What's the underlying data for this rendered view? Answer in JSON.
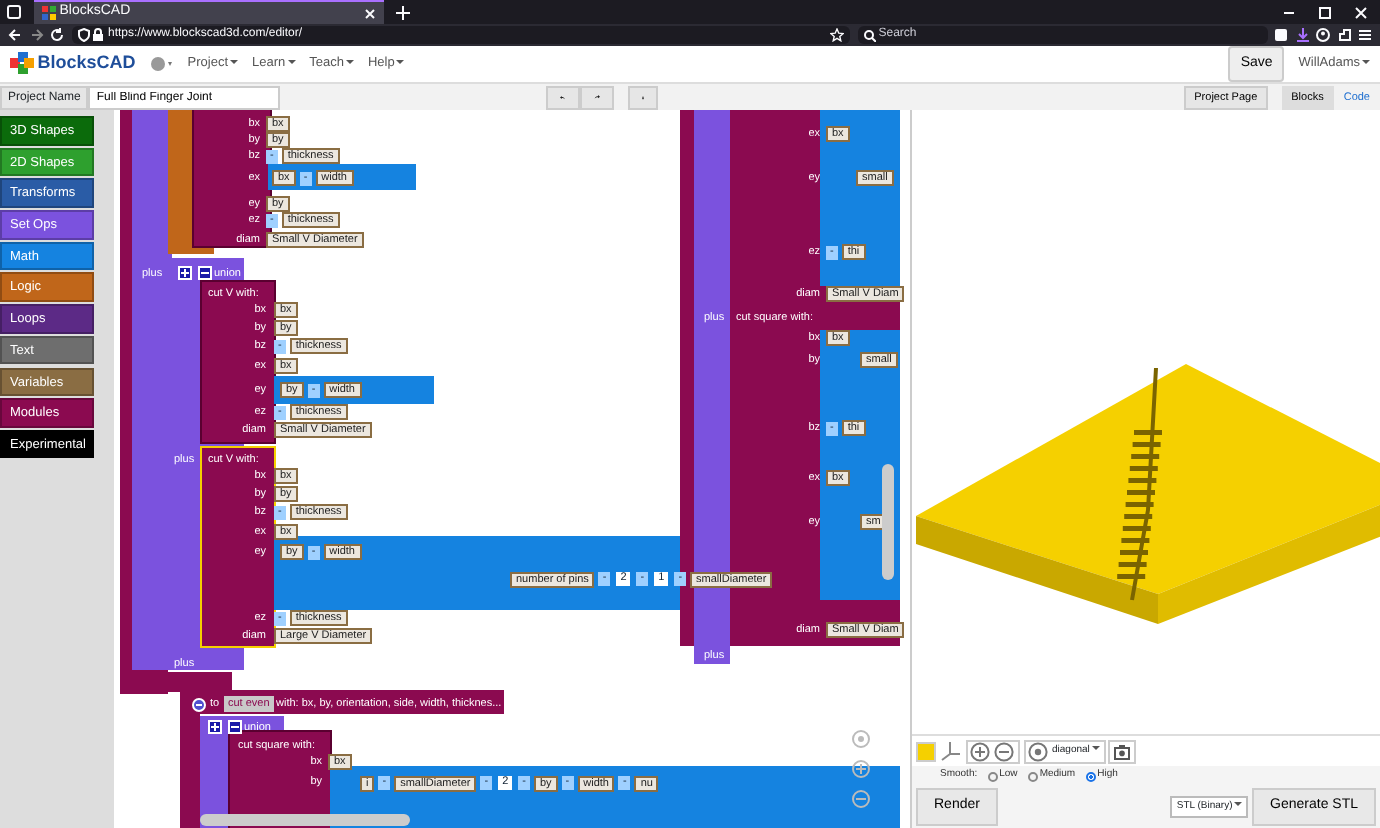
{
  "browser": {
    "tab_title": "BlocksCAD",
    "url": "https://www.blockscad3d.com/editor/",
    "search_placeholder": "Search"
  },
  "app_nav": {
    "brand": "BlocksCAD",
    "menus": [
      "Project",
      "Learn",
      "Teach",
      "Help"
    ],
    "save": "Save",
    "user": "WillAdams"
  },
  "project_bar": {
    "label": "Project Name",
    "name_value": "Full Blind Finger Joint",
    "project_page": "Project Page",
    "tabs": [
      {
        "label": "Blocks",
        "selected": true
      },
      {
        "label": "Code",
        "selected": false
      }
    ]
  },
  "categories": [
    {
      "label": "3D Shapes",
      "color": "#0b6b0b"
    },
    {
      "label": "2D Shapes",
      "color": "#2ea02e"
    },
    {
      "label": "Transforms",
      "color": "#2a5ca6"
    },
    {
      "label": "Set Ops",
      "color": "#7b52de"
    },
    {
      "label": "Math",
      "color": "#1583e0"
    },
    {
      "label": "Logic",
      "color": "#c0661a"
    },
    {
      "label": "Loops",
      "color": "#5c2a86"
    },
    {
      "label": "Text",
      "color": "#6e6e6e"
    },
    {
      "label": "Variables",
      "color": "#8a6d43"
    },
    {
      "label": "Modules",
      "color": "#8b0a50"
    },
    {
      "label": "Experimental",
      "color": "#000000"
    }
  ],
  "workspace": {
    "labels": [
      {
        "kind": "text",
        "text": "plus"
      },
      {
        "kind": "union",
        "text": "union"
      },
      {
        "kind": "text",
        "text": "cut V  with:"
      },
      {
        "kind": "text",
        "text": "plus"
      },
      {
        "kind": "text",
        "text": "cut V  with:"
      },
      {
        "kind": "text",
        "text": "plus"
      },
      {
        "kind": "module",
        "prefix": "to",
        "name": "cut even",
        "params": "with: bx, by, orientation, side, width, thicknes..."
      },
      {
        "kind": "union",
        "text": "union"
      },
      {
        "kind": "text",
        "text": "cut square  with:"
      },
      {
        "kind": "text",
        "text": "plus"
      },
      {
        "kind": "text",
        "text": "cut square  with:"
      },
      {
        "kind": "text",
        "text": "plus"
      }
    ],
    "rows": [
      {
        "label": "bx",
        "inputs": [
          {
            "kind": "var",
            "text": "bx"
          }
        ]
      },
      {
        "label": "by",
        "inputs": [
          {
            "kind": "var",
            "text": "by"
          }
        ]
      },
      {
        "label": "bz",
        "inputs": [
          {
            "kind": "op",
            "text": "-"
          },
          {
            "kind": "var",
            "text": "thickness"
          }
        ]
      },
      {
        "label": "ex",
        "inputs": [
          {
            "kind": "var",
            "text": "bx"
          },
          {
            "kind": "op",
            "text": "-"
          },
          {
            "kind": "var",
            "text": "width"
          }
        ]
      },
      {
        "label": "ey",
        "inputs": [
          {
            "kind": "var",
            "text": "by"
          }
        ]
      },
      {
        "label": "ez",
        "inputs": [
          {
            "kind": "op",
            "text": "-"
          },
          {
            "kind": "var",
            "text": "thickness"
          }
        ]
      },
      {
        "label": "diam",
        "inputs": [
          {
            "kind": "var",
            "text": "Small V Diameter"
          }
        ]
      },
      {
        "label": "bx",
        "inputs": [
          {
            "kind": "var",
            "text": "bx"
          }
        ]
      },
      {
        "label": "by",
        "inputs": [
          {
            "kind": "var",
            "text": "by"
          }
        ]
      },
      {
        "label": "bz",
        "inputs": [
          {
            "kind": "op",
            "text": "-"
          },
          {
            "kind": "var",
            "text": "thickness"
          }
        ]
      },
      {
        "label": "ex",
        "inputs": [
          {
            "kind": "var",
            "text": "bx"
          }
        ]
      },
      {
        "label": "ey",
        "inputs": [
          {
            "kind": "var",
            "text": "by"
          },
          {
            "kind": "op",
            "text": "-"
          },
          {
            "kind": "var",
            "text": "width"
          }
        ]
      },
      {
        "label": "ez",
        "inputs": [
          {
            "kind": "op",
            "text": "-"
          },
          {
            "kind": "var",
            "text": "thickness"
          }
        ]
      },
      {
        "label": "diam",
        "inputs": [
          {
            "kind": "var",
            "text": "Small V Diameter"
          }
        ]
      },
      {
        "label": "bx",
        "inputs": [
          {
            "kind": "var",
            "text": "bx"
          }
        ]
      },
      {
        "label": "by",
        "inputs": [
          {
            "kind": "var",
            "text": "by"
          }
        ]
      },
      {
        "label": "bz",
        "inputs": [
          {
            "kind": "op",
            "text": "-"
          },
          {
            "kind": "var",
            "text": "thickness"
          }
        ]
      },
      {
        "label": "ex",
        "inputs": [
          {
            "kind": "var",
            "text": "bx"
          }
        ]
      },
      {
        "label": "ey",
        "inputs": [
          {
            "kind": "var",
            "text": "by"
          },
          {
            "kind": "op",
            "text": "-"
          },
          {
            "kind": "var",
            "text": "width"
          }
        ]
      },
      {
        "inputs": [
          {
            "kind": "var",
            "text": "number of pins"
          },
          {
            "kind": "op",
            "text": "-"
          },
          {
            "kind": "num",
            "text": "2"
          },
          {
            "kind": "op",
            "text": "-"
          },
          {
            "kind": "num",
            "text": "1"
          },
          {
            "kind": "op",
            "text": "-"
          },
          {
            "kind": "var",
            "text": "smallDiameter"
          }
        ]
      },
      {
        "label": "ez",
        "inputs": [
          {
            "kind": "op",
            "text": "-"
          },
          {
            "kind": "var",
            "text": "thickness"
          }
        ]
      },
      {
        "label": "diam",
        "inputs": [
          {
            "kind": "var",
            "text": "Large V Diameter"
          }
        ]
      },
      {
        "label": "bx",
        "inputs": [
          {
            "kind": "var",
            "text": "bx"
          }
        ]
      },
      {
        "label": "by",
        "inputs": [
          {
            "kind": "var",
            "text": "i"
          },
          {
            "kind": "op",
            "text": "-"
          },
          {
            "kind": "var",
            "text": "smallDiameter"
          },
          {
            "kind": "op",
            "text": "-"
          },
          {
            "kind": "num",
            "text": "2"
          },
          {
            "kind": "op",
            "text": "-"
          },
          {
            "kind": "var",
            "text": "by"
          },
          {
            "kind": "op",
            "text": "-"
          },
          {
            "kind": "var",
            "text": "width"
          },
          {
            "kind": "op",
            "text": "-"
          },
          {
            "kind": "var",
            "text": "nu"
          }
        ]
      },
      {
        "label": "ex",
        "inputs": [
          {
            "kind": "var",
            "text": "bx"
          }
        ]
      },
      {
        "label": "ey",
        "inputs": [
          {
            "kind": "var",
            "text": "small"
          }
        ]
      },
      {
        "label": "ez",
        "inputs": [
          {
            "kind": "op",
            "text": "-"
          },
          {
            "kind": "var",
            "text": "thi"
          }
        ]
      },
      {
        "label": "diam",
        "inputs": [
          {
            "kind": "var",
            "text": "Small V Diam"
          }
        ]
      },
      {
        "label": "bx",
        "inputs": [
          {
            "kind": "var",
            "text": "bx"
          }
        ]
      },
      {
        "label": "by",
        "inputs": [
          {
            "kind": "var",
            "text": "small"
          }
        ]
      },
      {
        "label": "bz",
        "inputs": [
          {
            "kind": "op",
            "text": "-"
          },
          {
            "kind": "var",
            "text": "thi"
          }
        ]
      },
      {
        "label": "ex",
        "inputs": [
          {
            "kind": "var",
            "text": "bx"
          }
        ]
      },
      {
        "label": "ey",
        "inputs": [
          {
            "kind": "var",
            "text": "sm"
          }
        ]
      },
      {
        "label": "diam",
        "inputs": [
          {
            "kind": "var",
            "text": "Small V Diam"
          }
        ]
      }
    ]
  },
  "viewer": {
    "color": "#f5d000",
    "view": "diagonal",
    "smooth_label": "Smooth:",
    "smooth_options": [
      {
        "label": "Low",
        "selected": false
      },
      {
        "label": "Medium",
        "selected": false
      },
      {
        "label": "High",
        "selected": true
      }
    ],
    "render": "Render",
    "export_format": "STL (Binary)",
    "generate": "Generate STL"
  }
}
